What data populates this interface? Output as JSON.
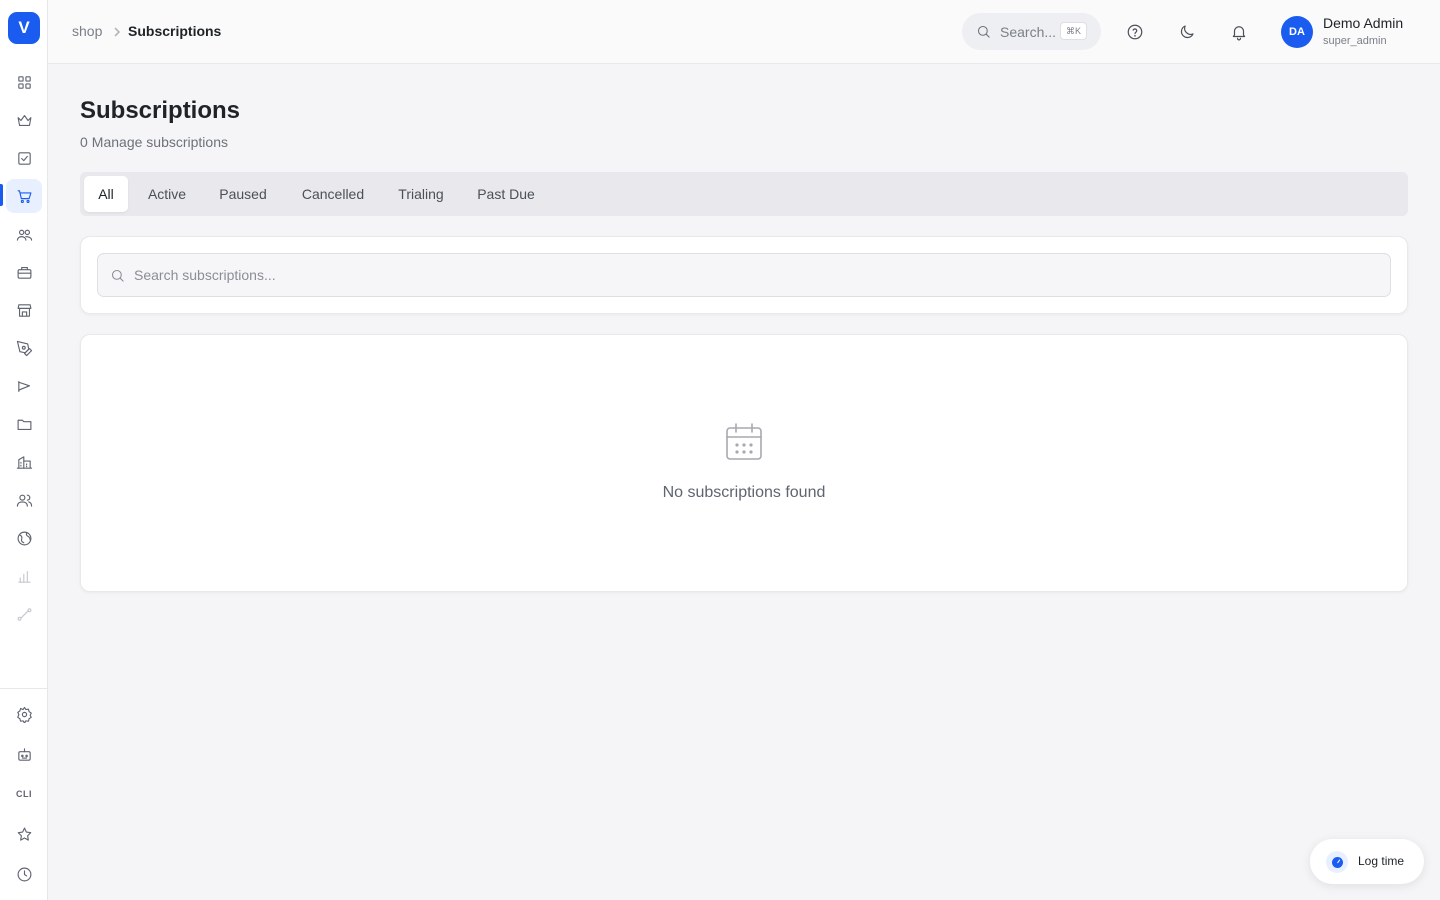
{
  "app": {
    "logo_letter": "V"
  },
  "breadcrumb": {
    "parent": "shop",
    "current": "Subscriptions"
  },
  "header": {
    "search_label": "Search...",
    "search_shortcut": "⌘K",
    "user": {
      "initials": "DA",
      "name": "Demo Admin",
      "role": "super_admin"
    }
  },
  "sidebar": {
    "items": [
      {
        "icon": "dashboard-grid-icon"
      },
      {
        "icon": "crown-icon"
      },
      {
        "icon": "checkbox-icon"
      },
      {
        "icon": "shopping-cart-icon",
        "active": true
      },
      {
        "icon": "users-group-icon"
      },
      {
        "icon": "briefcase-icon"
      },
      {
        "icon": "store-icon"
      },
      {
        "icon": "pen-tool-icon"
      },
      {
        "icon": "megaphone-icon"
      },
      {
        "icon": "folder-icon"
      },
      {
        "icon": "buildings-icon"
      },
      {
        "icon": "team-icon"
      },
      {
        "icon": "globe-icon"
      },
      {
        "icon": "bar-chart-icon"
      },
      {
        "icon": "route-icon"
      }
    ],
    "bottom": {
      "cli_label": "CLI"
    }
  },
  "page": {
    "title": "Subscriptions",
    "count": "0",
    "subtitle": "Manage subscriptions"
  },
  "tabs": [
    {
      "label": "All",
      "active": true
    },
    {
      "label": "Active"
    },
    {
      "label": "Paused"
    },
    {
      "label": "Cancelled"
    },
    {
      "label": "Trialing"
    },
    {
      "label": "Past Due"
    }
  ],
  "search": {
    "placeholder": "Search subscriptions..."
  },
  "empty_state": {
    "message": "No subscriptions found"
  },
  "log_time": {
    "label": "Log time"
  },
  "colors": {
    "accent": "#1a5cf0",
    "background": "#f5f5f7"
  }
}
